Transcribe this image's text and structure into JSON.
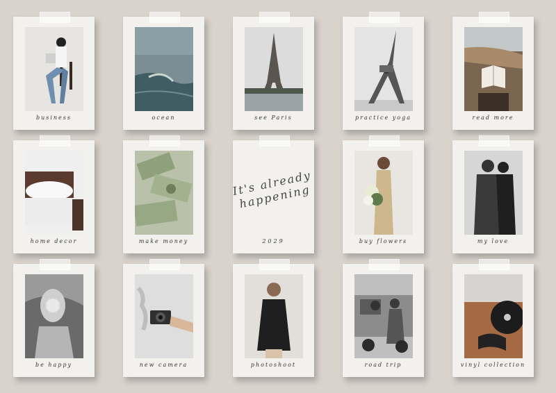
{
  "board": {
    "cards": [
      {
        "caption": "business"
      },
      {
        "caption": "ocean"
      },
      {
        "caption": "see Paris"
      },
      {
        "caption": "practice yoga"
      },
      {
        "caption": "read more"
      },
      {
        "caption": "home decor"
      },
      {
        "caption": "make money"
      },
      {
        "note_line1": "It's already",
        "note_line2": "happening",
        "year": "2029"
      },
      {
        "caption": "buy flowers"
      },
      {
        "caption": "my love"
      },
      {
        "caption": "be happy"
      },
      {
        "caption": "new camera"
      },
      {
        "caption": "photoshoot"
      },
      {
        "caption": "road trip"
      },
      {
        "caption": "vinyl collection"
      }
    ]
  },
  "colors": {
    "background": "#d9d3cc",
    "card": "#f2f1ee",
    "caption_text": "#333333"
  }
}
